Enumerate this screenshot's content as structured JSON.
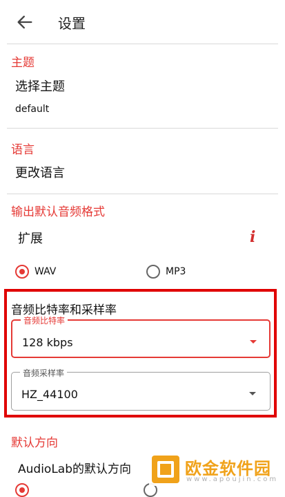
{
  "toolbar": {
    "title": "设置",
    "back_icon": "arrow-left-icon"
  },
  "theme": {
    "header": "主题",
    "title": "选择主题",
    "value": "default"
  },
  "language": {
    "header": "语言",
    "title": "更改语言"
  },
  "output": {
    "header": "输出默认音频格式",
    "extension_label": "扩展",
    "info_icon": "info-icon",
    "options": [
      {
        "label": "WAV",
        "selected": true
      },
      {
        "label": "MP3",
        "selected": false
      }
    ]
  },
  "bitrate_section": {
    "title": "音频比特率和采样率",
    "bitrate": {
      "legend": "音频比特率",
      "value": "128 kbps"
    },
    "samplerate": {
      "legend": "音频采样率",
      "value": "HZ_44100"
    }
  },
  "orientation": {
    "header": "默认方向",
    "title": "AudioLab的默认方向"
  },
  "watermark": {
    "name": "欧金软件园",
    "url": "www.apoujin.com"
  },
  "colors": {
    "accent": "#e53935",
    "highlight": "#e00000",
    "watermark": "#f0a21a"
  }
}
